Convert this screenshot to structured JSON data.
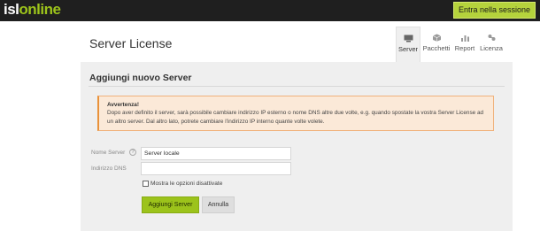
{
  "header": {
    "logo_part1": "isl",
    "logo_part2": "online",
    "login_label": "Entra nella sessione"
  },
  "page": {
    "title": "Server License"
  },
  "tabs": [
    {
      "label": "Server",
      "icon": "server-icon",
      "active": true
    },
    {
      "label": "Pacchetti",
      "icon": "package-icon",
      "active": false
    },
    {
      "label": "Report",
      "icon": "report-icon",
      "active": false
    },
    {
      "label": "Licenza",
      "icon": "license-icon",
      "active": false
    }
  ],
  "panel": {
    "title": "Aggiungi nuovo Server",
    "warning_title": "Avvertenza!",
    "warning_text": "Dopo aver definito il server, sarà possibile cambiare indirizzo IP esterno o nome DNS altre due volte, e.g. quando spostate la vostra Server License ad un altro server. Dal altro lato, potrete cambiare l'indirizzo IP interno quante volte volete.",
    "server_name_label": "Nome Server",
    "server_name_value": "Server locale",
    "dns_label": "Indirizzo DNS",
    "dns_value": "",
    "show_disabled_label": "Mostra le opzioni disattivate",
    "show_disabled_checked": false,
    "add_button": "Aggiungi Server",
    "cancel_button": "Annulla"
  },
  "colors": {
    "accent": "#9cc31b",
    "topbar": "#1f1f1f",
    "warning_bg": "#fbe9d8",
    "warning_border": "#e9923a"
  }
}
